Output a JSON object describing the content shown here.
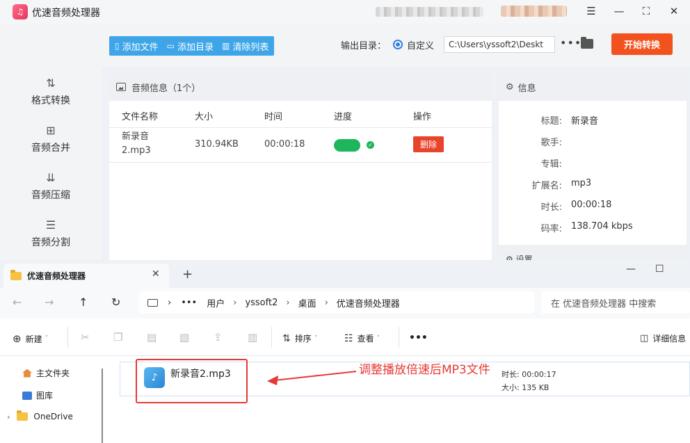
{
  "app": {
    "title": "优速音频处理器",
    "logo_glyph": "♫"
  },
  "window_controls": {
    "menu": "☰",
    "minimize": "—",
    "maximize": "⛶",
    "close": "✕"
  },
  "sidebar": {
    "items": [
      {
        "label": "格式转换",
        "icon": "⇅"
      },
      {
        "label": "音频合并",
        "icon": "⊞"
      },
      {
        "label": "音频压缩",
        "icon": "⇊"
      },
      {
        "label": "音频分割",
        "icon": "☰"
      }
    ]
  },
  "toolbar": {
    "add_file": "添加文件",
    "add_dir": "添加目录",
    "clear_list": "清除列表",
    "output_label": "输出目录：",
    "radio_label": "自定义",
    "path_value": "C:\\Users\\yssoft2\\Deskt",
    "more": "•••",
    "start_button": "开始转换"
  },
  "audio_panel": {
    "title": "音频信息（1个）",
    "columns": {
      "name": "文件名称",
      "size": "大小",
      "time": "时间",
      "progress": "进度",
      "action": "操作"
    },
    "rows": [
      {
        "name": "新录音2.mp3",
        "size": "310.94KB",
        "time": "00:00:18",
        "progress": 1.0,
        "action": "删除"
      }
    ]
  },
  "info_panel": {
    "title": "信息",
    "fields": [
      {
        "key": "标题:",
        "value": "新录音"
      },
      {
        "key": "歌手:",
        "value": ""
      },
      {
        "key": "专辑:",
        "value": ""
      },
      {
        "key": "扩展名:",
        "value": "mp3"
      },
      {
        "key": "时长:",
        "value": "00:00:18"
      },
      {
        "key": "码率:",
        "value": "138.704 kbps"
      }
    ],
    "settings_title": "设置"
  },
  "explorer": {
    "tab_title": "优速音频处理器",
    "tab_close": "✕",
    "tab_add": "+",
    "win_min": "—",
    "win_max": "☐",
    "nav": {
      "back": "←",
      "forward": "→",
      "up": "↑",
      "refresh": "↻"
    },
    "breadcrumb": {
      "more": "•••",
      "c1": "用户",
      "c2": "yssoft2",
      "c3": "桌面",
      "c4": "优速音频处理器",
      "sep": "›"
    },
    "search_placeholder": "在 优速音频处理器 中搜索",
    "cmd": {
      "new": "新建",
      "sort": "排序",
      "view": "查看",
      "more": "•••",
      "details": "详细信息"
    },
    "nav_pane": {
      "home": "主文件夹",
      "gallery": "图库",
      "onedrive": "OneDrive"
    },
    "file": {
      "name": "新录音2.mp3",
      "meta_duration": "时长: 00:00:17",
      "meta_size": "大小: 135 KB"
    },
    "annotation": "调整播放倍速后MP3文件"
  },
  "colors": {
    "accent": "#3da5e8",
    "start": "#f2531e",
    "progress": "#1eb65a",
    "delete": "#e8442b",
    "annot": "#e53935"
  }
}
